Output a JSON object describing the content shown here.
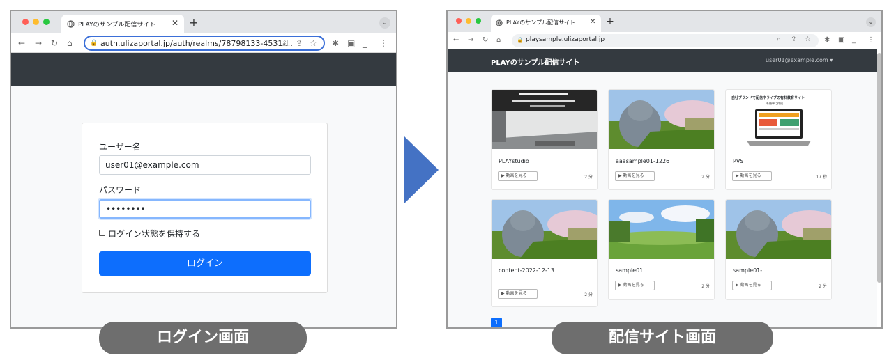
{
  "left_window": {
    "tab_title": "PLAYのサンプル配信サイト",
    "url": "auth.ulizaportal.jp/auth/realms/78798133-4531-...",
    "username_label": "ユーザー名",
    "username_value": "user01@example.com",
    "password_label": "パスワード",
    "password_value": "••••••••",
    "remember_label": "ログイン状態を保持する",
    "login_button": "ログイン",
    "caption": "ログイン画面"
  },
  "right_window": {
    "tab_title": "PLAYのサンプル配信サイト",
    "url": "playsample.ulizaportal.jp",
    "brand": "PLAYのサンプル配信サイト",
    "user_menu": "user01@example.com ▾",
    "watch_label": "▶ 動画を見る",
    "videos": [
      {
        "title": "PLAYstudio",
        "duration": "2 分"
      },
      {
        "title": "aaasample01-1226",
        "duration": "2 分"
      },
      {
        "title": "PVS",
        "duration": "17 秒"
      },
      {
        "title": "content-2022-12-13",
        "duration": "2 分"
      },
      {
        "title": "sample01",
        "duration": "2 分"
      },
      {
        "title": "sample01-",
        "duration": "2 分"
      }
    ],
    "pvs_headline": "自社ブランドで配信やライブの有料教育サイト",
    "pvs_sub": "を簡単に作成",
    "page_number": "1",
    "caption": "配信サイト画面"
  },
  "colors": {
    "primary": "#0d6efd",
    "navbar": "#343a40",
    "arrow": "#4472c4",
    "caption_pill": "#6e6e6e"
  }
}
